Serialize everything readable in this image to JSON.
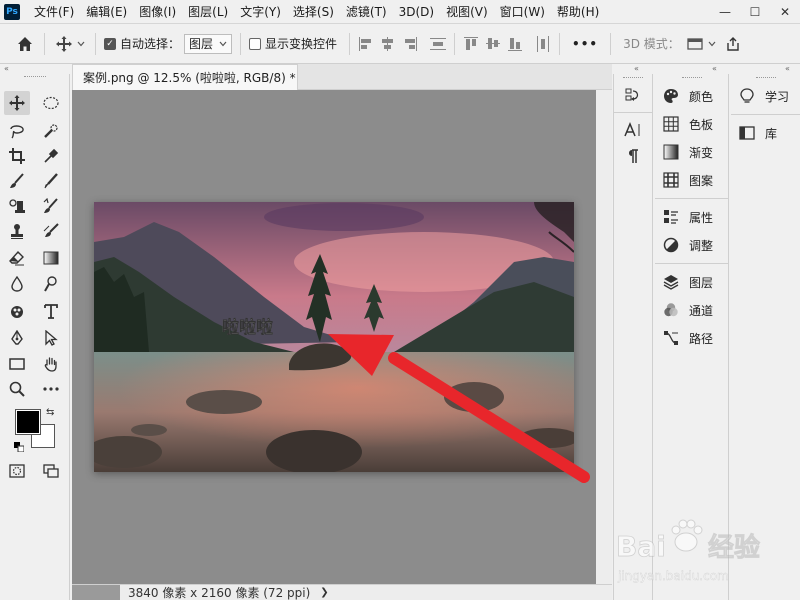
{
  "app": {
    "logo": "Ps"
  },
  "menu": [
    "文件(F)",
    "编辑(E)",
    "图像(I)",
    "图层(L)",
    "文字(Y)",
    "选择(S)",
    "滤镜(T)",
    "3D(D)",
    "视图(V)",
    "窗口(W)",
    "帮助(H)"
  ],
  "window_controls": {
    "minimize": "—",
    "maximize": "☐",
    "close": "✕"
  },
  "options": {
    "auto_select_label": "自动选择：",
    "auto_select_checked": true,
    "auto_select_value": "图层",
    "show_transform_label": "显示变换控件",
    "show_transform_checked": false,
    "more": "•••",
    "mode_label": "3D 模式："
  },
  "document": {
    "tab_title": "案例.png @ 12.5% (啦啦啦, RGB/8) *",
    "close": "✕",
    "canvas_text": "啦啦啦",
    "status": "3840 像素 x 2160 像素 (72 ppi)",
    "status_arrow": "❯"
  },
  "panels": {
    "col2": [
      {
        "name": "color",
        "label": "颜色",
        "icon": "palette-icon"
      },
      {
        "name": "swatches",
        "label": "色板",
        "icon": "grid-icon"
      },
      {
        "name": "gradients",
        "label": "渐变",
        "icon": "gradient-icon"
      },
      {
        "name": "patterns",
        "label": "图案",
        "icon": "pattern-icon"
      },
      {
        "name": "properties",
        "label": "属性",
        "icon": "properties-icon"
      },
      {
        "name": "adjustments",
        "label": "调整",
        "icon": "adjust-icon"
      },
      {
        "name": "layers",
        "label": "图层",
        "icon": "layers-icon"
      },
      {
        "name": "channels",
        "label": "通道",
        "icon": "channels-icon"
      },
      {
        "name": "paths",
        "label": "路径",
        "icon": "paths-icon"
      }
    ],
    "col3": [
      {
        "name": "learn",
        "label": "学习",
        "icon": "bulb-icon"
      },
      {
        "name": "libraries",
        "label": "库",
        "icon": "library-icon"
      }
    ]
  },
  "colors": {
    "foreground": "#000000",
    "background": "#ffffff",
    "arrow": "#e8262b",
    "canvas_bg": "#8c8c8c"
  },
  "watermark": {
    "brand": "Bai",
    "brand2": "经验",
    "url": "jingyan.baidu.com"
  }
}
